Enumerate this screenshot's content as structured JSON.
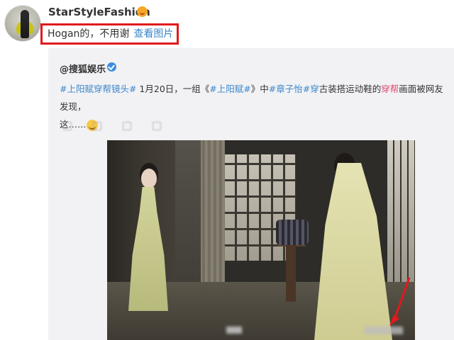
{
  "post": {
    "username": "StarStyleFashion",
    "text": "Hogan的，不用谢",
    "view_image": "查看图片",
    "badge": "crown-emoji-icon"
  },
  "repost": {
    "username": "@搜狐娱乐",
    "verified": "verified-icon",
    "tag1": "#上阳赋穿帮镜头#",
    "date_text": " 1月20日，一组《",
    "tag2": "#上阳赋#",
    "mid_text": "》中",
    "tag3": "#章子怡#",
    "tag4": "穿",
    "shoe_text": "古装搭运动鞋的",
    "tag5": "穿帮",
    "end_text": "画面被网友发现，",
    "line2": "这……",
    "actions": [
      "",
      "",
      " ",
      ""
    ]
  },
  "colors": {
    "accent_link": "#3b86c8",
    "highlight_border": "#e0191b",
    "tag_pink": "#e0476e"
  }
}
